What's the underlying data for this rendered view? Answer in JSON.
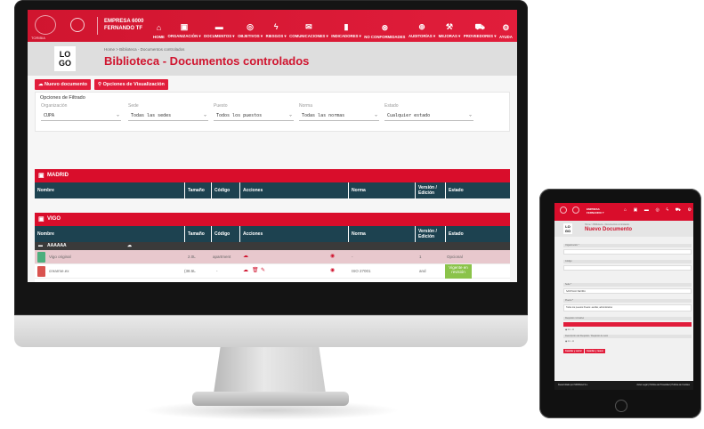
{
  "header": {
    "company_line1": "EMPRESA 6000",
    "company_line2": "FERNANDO TF",
    "brand_small": "TORIBIA",
    "nav": [
      {
        "label": "HOME",
        "icon": "home-icon",
        "glyph": "⌂"
      },
      {
        "label": "ORGANIZACIÓN ▾",
        "icon": "briefcase-icon",
        "glyph": "▣"
      },
      {
        "label": "DOCUMENTOS ▾",
        "icon": "folder-icon",
        "glyph": "▬"
      },
      {
        "label": "OBJETIVOS ▾",
        "icon": "target-icon",
        "glyph": "◎"
      },
      {
        "label": "RIESGOS ▾",
        "icon": "bolt-icon",
        "glyph": "ϟ"
      },
      {
        "label": "COMUNICACIONES ▾",
        "icon": "mail-icon",
        "glyph": "✉"
      },
      {
        "label": "INDICADORES ▾",
        "icon": "tag-icon",
        "glyph": "▮"
      },
      {
        "label": "NO CONFORMIDADES",
        "icon": "alert-icon",
        "glyph": "⊗"
      },
      {
        "label": "AUDITORÍAS ▾",
        "icon": "globe-icon",
        "glyph": "⊕"
      },
      {
        "label": "MEJORAS ▾",
        "icon": "wrench-icon",
        "glyph": "⚒"
      },
      {
        "label": "PROVEEDORES ▾",
        "icon": "truck-icon",
        "glyph": "⛟"
      },
      {
        "label": "AYUDA",
        "icon": "gear-icon",
        "glyph": "⚙"
      }
    ]
  },
  "title_band": {
    "logo": "LO GO",
    "breadcrumb": "Home > Biblioteca - Documentos controlados",
    "title": "Biblioteca - Documentos controlados"
  },
  "actions": {
    "new_document": "Nuevo documento",
    "view_options": "Opciones de Visualización"
  },
  "filters": {
    "title": "Opciones de Filtrado",
    "fields": [
      {
        "label": "Organización",
        "value": "CUPA"
      },
      {
        "label": "Sede",
        "value": "Todas las sedes"
      },
      {
        "label": "Puesto",
        "value": "Todos los puestos"
      },
      {
        "label": "Norma",
        "value": "Todas las normas"
      },
      {
        "label": "Estado",
        "value": "Cualquier estado"
      }
    ]
  },
  "columns": [
    "Nombre",
    "Tamaño",
    "Código",
    "Acciones",
    "Norma",
    "Versión / Edición",
    "Estado"
  ],
  "sections": [
    {
      "name": "MADRID"
    },
    {
      "name": "VIGO",
      "folder": "AAAAAA",
      "rows": [
        {
          "name": "Vigo original",
          "size": "2.0L",
          "code": "apartment",
          "norma": "-",
          "version": "1",
          "estado": "Opcional",
          "tint": "#e8c8cd"
        },
        {
          "name": "crearme.ex",
          "size": "(38.5L",
          "code": "-",
          "norma": "ISO 27001",
          "version": "and",
          "estado": "Vigente en revisión",
          "tint": "#ffffff"
        }
      ]
    }
  ],
  "ipad": {
    "company_line1": "EMPRESA",
    "company_line2": "FERNANDO T",
    "logo": "LO GO",
    "breadcrumb": "Home > Biblioteca - Documentos controlados",
    "title": "Nuevo Documento",
    "fields": [
      "Organización *",
      "Código",
      "Sede *",
      "Puesto *",
      "Requisito normativo",
      "Descripción del Requisito / Requisito de texto"
    ],
    "sede_value": "SANTIAGO SEVIRA",
    "puesto_value": "Todos los puestos  Puesto: auxiliar, administrativo",
    "save": "Guardar y cerrar",
    "save_new": "Guardar y nuevo",
    "footer_left": "Desarrollado por MORAGA S.L.",
    "footer_right": "Aviso Legal  |  Política de Privacidad  |  Política de Cookies"
  },
  "colors": {
    "brand_red": "#d90d2b",
    "table_header": "#1d4250"
  }
}
